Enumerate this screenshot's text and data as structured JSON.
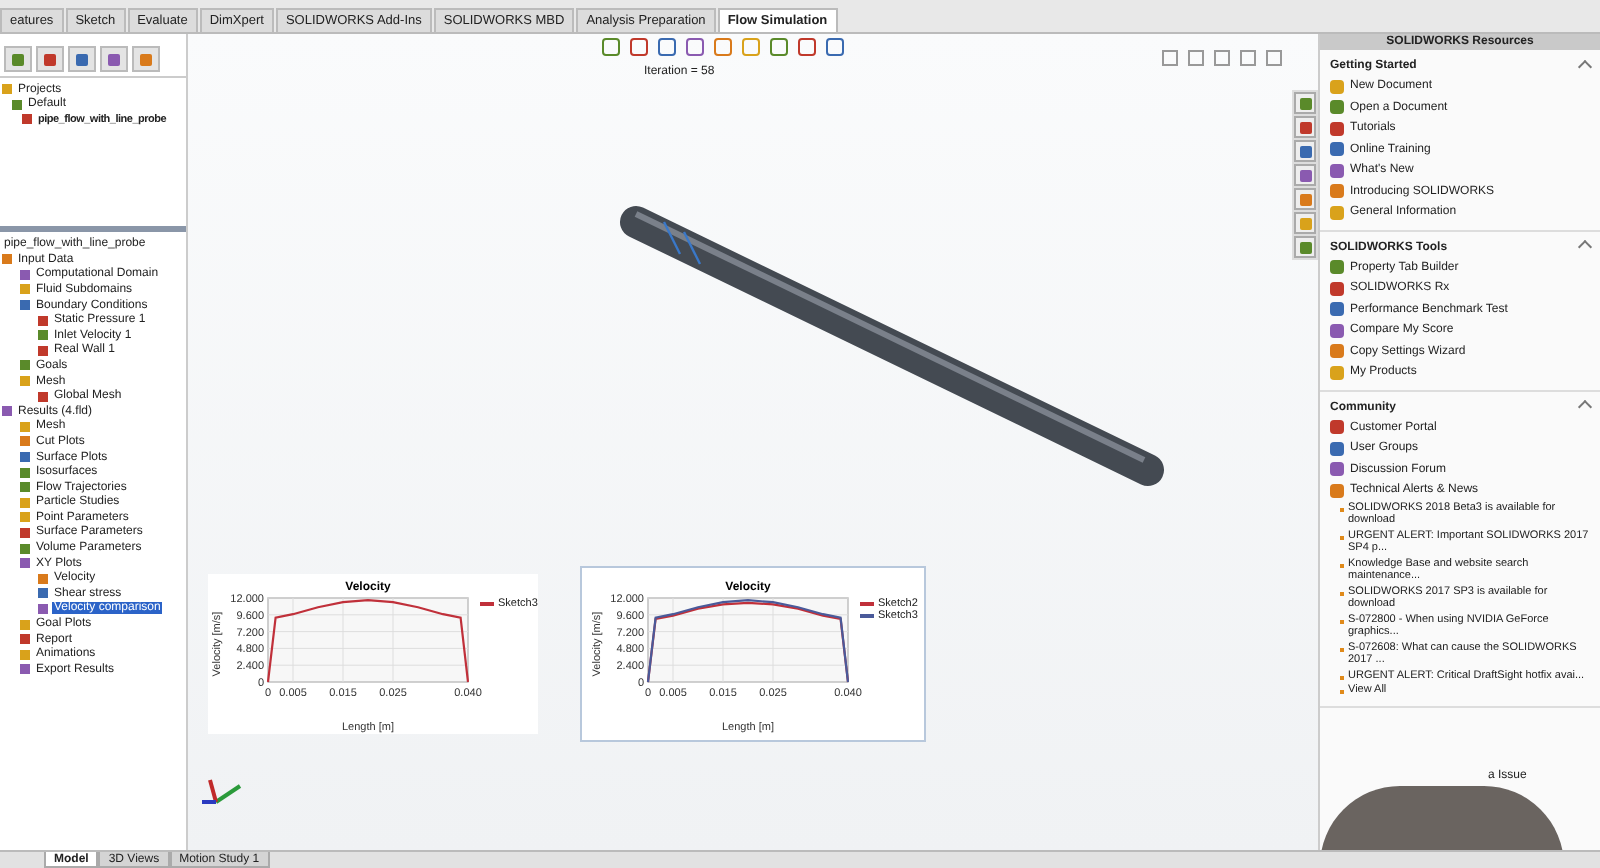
{
  "command_tabs": [
    {
      "label": "eatures",
      "selected": false
    },
    {
      "label": "Sketch",
      "selected": false
    },
    {
      "label": "Evaluate",
      "selected": false
    },
    {
      "label": "DimXpert",
      "selected": false
    },
    {
      "label": "SOLIDWORKS Add-Ins",
      "selected": false
    },
    {
      "label": "SOLIDWORKS MBD",
      "selected": false
    },
    {
      "label": "Analysis Preparation",
      "selected": false
    },
    {
      "label": "Flow Simulation",
      "selected": true
    }
  ],
  "project_tree": [
    {
      "label": "Projects",
      "active": false,
      "selected": false,
      "children": [
        {
          "label": "Default",
          "active": false,
          "selected": false,
          "children": [
            {
              "label": "pipe_flow_with_line_probe",
              "active": true,
              "selected": false
            }
          ]
        }
      ]
    }
  ],
  "analysis_tree": {
    "title": "pipe_flow_with_line_probe",
    "items": [
      {
        "label": "Input Data",
        "selected": false,
        "children": [
          {
            "label": "Computational Domain",
            "selected": false
          },
          {
            "label": "Fluid Subdomains",
            "selected": false
          },
          {
            "label": "Boundary Conditions",
            "selected": false,
            "children": [
              {
                "label": "Static Pressure 1",
                "selected": false
              },
              {
                "label": "Inlet Velocity 1",
                "selected": false
              },
              {
                "label": "Real Wall 1",
                "selected": false
              }
            ]
          },
          {
            "label": "Goals",
            "selected": false
          },
          {
            "label": "Mesh",
            "selected": false,
            "children": [
              {
                "label": "Global Mesh",
                "selected": false
              }
            ]
          }
        ]
      },
      {
        "label": "Results (4.fld)",
        "selected": false,
        "children": [
          {
            "label": "Mesh",
            "selected": false
          },
          {
            "label": "Cut Plots",
            "selected": false
          },
          {
            "label": "Surface Plots",
            "selected": false
          },
          {
            "label": "Isosurfaces",
            "selected": false
          },
          {
            "label": "Flow Trajectories",
            "selected": false
          },
          {
            "label": "Particle Studies",
            "selected": false
          },
          {
            "label": "Point Parameters",
            "selected": false
          },
          {
            "label": "Surface Parameters",
            "selected": false
          },
          {
            "label": "Volume Parameters",
            "selected": false
          },
          {
            "label": "XY Plots",
            "selected": false,
            "children": [
              {
                "label": "Velocity",
                "selected": false
              },
              {
                "label": "Shear stress",
                "selected": false
              },
              {
                "label": "Velocity comparison",
                "selected": true
              }
            ]
          },
          {
            "label": "Goal Plots",
            "selected": false
          },
          {
            "label": "Report",
            "selected": false
          },
          {
            "label": "Animations",
            "selected": false
          },
          {
            "label": "Export Results",
            "selected": false
          }
        ]
      }
    ]
  },
  "viewport": {
    "iteration": "Iteration = 58",
    "charts": [
      {
        "framed": false,
        "chart_data": {
          "type": "line",
          "grid": true,
          "legend": "right",
          "title": "Velocity",
          "xlabel": "Length [m]",
          "ylabel": "Velocity [m/s]",
          "x": [
            0,
            0.0015,
            0.005,
            0.01,
            0.015,
            0.02,
            0.025,
            0.03,
            0.035,
            0.0385,
            0.04
          ],
          "series": [
            {
              "name": "Sketch3",
              "color": "#c0303a",
              "values": [
                0,
                9.2,
                9.7,
                10.7,
                11.4,
                11.7,
                11.4,
                10.7,
                9.7,
                9.2,
                0
              ]
            }
          ],
          "xlim": [
            0,
            0.04
          ],
          "ylim": [
            0,
            12
          ],
          "xticks": [
            {
              "value": 0,
              "label": "0"
            },
            {
              "value": 0.005,
              "label": "0.005"
            },
            {
              "value": 0.015,
              "label": "0.015"
            },
            {
              "value": 0.025,
              "label": "0.025"
            },
            {
              "value": 0.04,
              "label": "0.040"
            }
          ],
          "yticks": [
            {
              "value": 0,
              "label": "0"
            },
            {
              "value": 2.4,
              "label": "2.400"
            },
            {
              "value": 4.8,
              "label": "4.800"
            },
            {
              "value": 7.2,
              "label": "7.200"
            },
            {
              "value": 9.6,
              "label": "9.600"
            },
            {
              "value": 12,
              "label": "12.000"
            }
          ]
        }
      },
      {
        "framed": true,
        "chart_data": {
          "type": "line",
          "grid": true,
          "legend": "right",
          "title": "Velocity",
          "xlabel": "Length [m]",
          "ylabel": "Velocity [m/s]",
          "x": [
            0,
            0.0015,
            0.005,
            0.01,
            0.015,
            0.02,
            0.025,
            0.03,
            0.035,
            0.0385,
            0.04
          ],
          "series": [
            {
              "name": "Sketch2",
              "color": "#c0303a",
              "values": [
                0,
                9.0,
                9.5,
                10.5,
                11.1,
                11.3,
                11.1,
                10.5,
                9.5,
                9.0,
                0
              ]
            },
            {
              "name": "Sketch3",
              "color": "#4a5a9a",
              "values": [
                0,
                9.2,
                9.7,
                10.7,
                11.4,
                11.7,
                11.4,
                10.7,
                9.7,
                9.2,
                0
              ]
            }
          ],
          "xlim": [
            0,
            0.04
          ],
          "ylim": [
            0,
            12
          ],
          "xticks": [
            {
              "value": 0,
              "label": "0"
            },
            {
              "value": 0.005,
              "label": "0.005"
            },
            {
              "value": 0.015,
              "label": "0.015"
            },
            {
              "value": 0.025,
              "label": "0.025"
            },
            {
              "value": 0.04,
              "label": "0.040"
            }
          ],
          "yticks": [
            {
              "value": 0,
              "label": "0"
            },
            {
              "value": 2.4,
              "label": "2.400"
            },
            {
              "value": 4.8,
              "label": "4.800"
            },
            {
              "value": 7.2,
              "label": "7.200"
            },
            {
              "value": 9.6,
              "label": "9.600"
            },
            {
              "value": 12,
              "label": "12.000"
            }
          ]
        }
      }
    ]
  },
  "resources_panel": {
    "title": "SOLIDWORKS Resources",
    "sections": [
      {
        "title": "Getting Started",
        "items": [
          "New Document",
          "Open a Document",
          "Tutorials",
          "Online Training",
          "What's New",
          "Introducing SOLIDWORKS",
          "General Information"
        ]
      },
      {
        "title": "SOLIDWORKS Tools",
        "items": [
          "Property Tab Builder",
          "SOLIDWORKS Rx",
          "Performance Benchmark Test",
          "Compare My Score",
          "Copy Settings Wizard",
          "My Products"
        ]
      },
      {
        "title": "Community",
        "items": [
          "Customer Portal",
          "User Groups",
          "Discussion Forum",
          "Technical Alerts & News"
        ],
        "alerts": [
          "SOLIDWORKS 2018 Beta3 is available for download",
          "URGENT ALERT: Important SOLIDWORKS 2017 SP4 p...",
          "Knowledge Base and website search maintenance...",
          "SOLIDWORKS 2017 SP3 is available for download",
          "S-072800 - When using NVIDIA GeForce graphics...",
          "S-072608: What can cause the SOLIDWORKS 2017 ...",
          "URGENT ALERT: Critical DraftSight hotfix avai..."
        ],
        "view_all": "View All"
      }
    ],
    "covered_fragment": "a Issue"
  },
  "bottom_tabs": [
    {
      "label": "Model",
      "selected": true
    },
    {
      "label": "3D Views",
      "selected": false
    },
    {
      "label": "Motion Study 1",
      "selected": false
    }
  ]
}
